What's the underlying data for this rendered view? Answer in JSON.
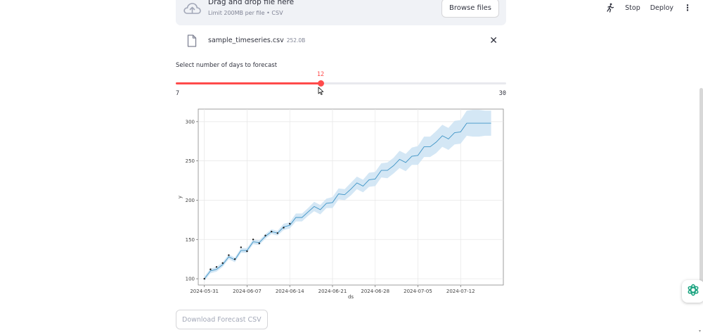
{
  "header": {
    "stop_label": "Stop",
    "deploy_label": "Deploy",
    "menu_glyph": "⋮",
    "running_icon": "running-man-icon"
  },
  "uploader": {
    "title": "Drag and drop file here",
    "limit": "Limit 200MB per file • CSV",
    "browse_label": "Browse files",
    "icon": "cloud-upload-icon"
  },
  "file": {
    "name": "sample_timeseries.csv",
    "size": "252.0B",
    "close_glyph": "✕",
    "icon": "file-icon"
  },
  "slider": {
    "label": "Select number of days to forecast",
    "min": 7,
    "max": 30,
    "value": 12,
    "min_label": "7",
    "max_label": "30",
    "value_label": "12",
    "accent": "#ff4b4b"
  },
  "chart_data": {
    "type": "line",
    "title": "",
    "xlabel": "ds",
    "ylabel": "y",
    "grid": true,
    "x_ticks": [
      "2024-05-31",
      "2024-06-07",
      "2024-06-14",
      "2024-06-21",
      "2024-06-28",
      "2024-07-05",
      "2024-07-12"
    ],
    "y_ticks": [
      100,
      150,
      200,
      250,
      300
    ],
    "x_range": [
      "2024-05-30",
      "2024-07-19"
    ],
    "ylim": [
      92,
      316
    ],
    "series": [
      {
        "kind": "observed-points",
        "color": "#1a1a1a",
        "x": [
          "2024-05-31",
          "2024-06-01",
          "2024-06-02",
          "2024-06-03",
          "2024-06-04",
          "2024-06-05",
          "2024-06-06",
          "2024-06-07",
          "2024-06-08",
          "2024-06-09",
          "2024-06-10",
          "2024-06-11",
          "2024-06-12",
          "2024-06-13",
          "2024-06-14"
        ],
        "y": [
          100,
          112,
          115,
          120,
          130,
          125,
          140,
          135,
          150,
          145,
          155,
          160,
          158,
          165,
          170
        ]
      },
      {
        "kind": "forecast-line",
        "color": "#0072b2",
        "x": [
          "2024-05-31",
          "2024-06-01",
          "2024-06-02",
          "2024-06-03",
          "2024-06-04",
          "2024-06-05",
          "2024-06-06",
          "2024-06-07",
          "2024-06-08",
          "2024-06-09",
          "2024-06-10",
          "2024-06-11",
          "2024-06-12",
          "2024-06-13",
          "2024-06-14",
          "2024-06-15",
          "2024-06-16",
          "2024-06-17",
          "2024-06-18",
          "2024-06-19",
          "2024-06-20",
          "2024-06-21",
          "2024-06-22",
          "2024-06-23",
          "2024-06-24",
          "2024-06-25",
          "2024-06-26",
          "2024-06-27",
          "2024-06-28",
          "2024-06-29",
          "2024-06-30",
          "2024-07-01",
          "2024-07-02",
          "2024-07-03",
          "2024-07-04",
          "2024-07-05",
          "2024-07-06",
          "2024-07-07",
          "2024-07-08",
          "2024-07-09",
          "2024-07-10",
          "2024-07-11",
          "2024-07-12",
          "2024-07-13",
          "2024-07-14",
          "2024-07-15",
          "2024-07-16",
          "2024-07-17"
        ],
        "y": [
          100,
          110,
          112,
          118,
          128,
          124,
          136,
          136,
          147,
          146,
          154,
          160,
          158,
          166,
          168,
          178,
          178,
          185,
          192,
          188,
          196,
          197,
          208,
          207,
          214,
          222,
          218,
          226,
          227,
          238,
          238,
          244,
          252,
          248,
          256,
          257,
          268,
          268,
          274,
          282,
          278,
          286,
          287,
          298,
          298,
          298,
          298,
          298
        ],
        "lower": [
          97,
          107,
          109,
          115,
          125,
          121,
          133,
          133,
          144,
          143,
          151,
          157,
          155,
          162,
          164,
          173,
          173,
          180,
          186,
          182,
          190,
          190,
          201,
          200,
          206,
          214,
          210,
          217,
          218,
          229,
          228,
          234,
          241,
          237,
          245,
          245,
          255,
          255,
          260,
          268,
          264,
          271,
          272,
          282,
          281,
          281,
          282,
          282
        ],
        "upper": [
          103,
          113,
          115,
          121,
          131,
          127,
          139,
          139,
          150,
          149,
          157,
          163,
          161,
          170,
          172,
          183,
          183,
          190,
          198,
          194,
          202,
          204,
          215,
          214,
          222,
          230,
          226,
          235,
          236,
          247,
          248,
          254,
          263,
          259,
          267,
          269,
          281,
          281,
          288,
          296,
          292,
          301,
          302,
          314,
          315,
          315,
          314,
          314
        ]
      }
    ],
    "band_color": "#cde3f3"
  },
  "download": {
    "label": "Download Forecast CSV"
  },
  "assistant": {
    "icon": "openai-knot-icon"
  }
}
